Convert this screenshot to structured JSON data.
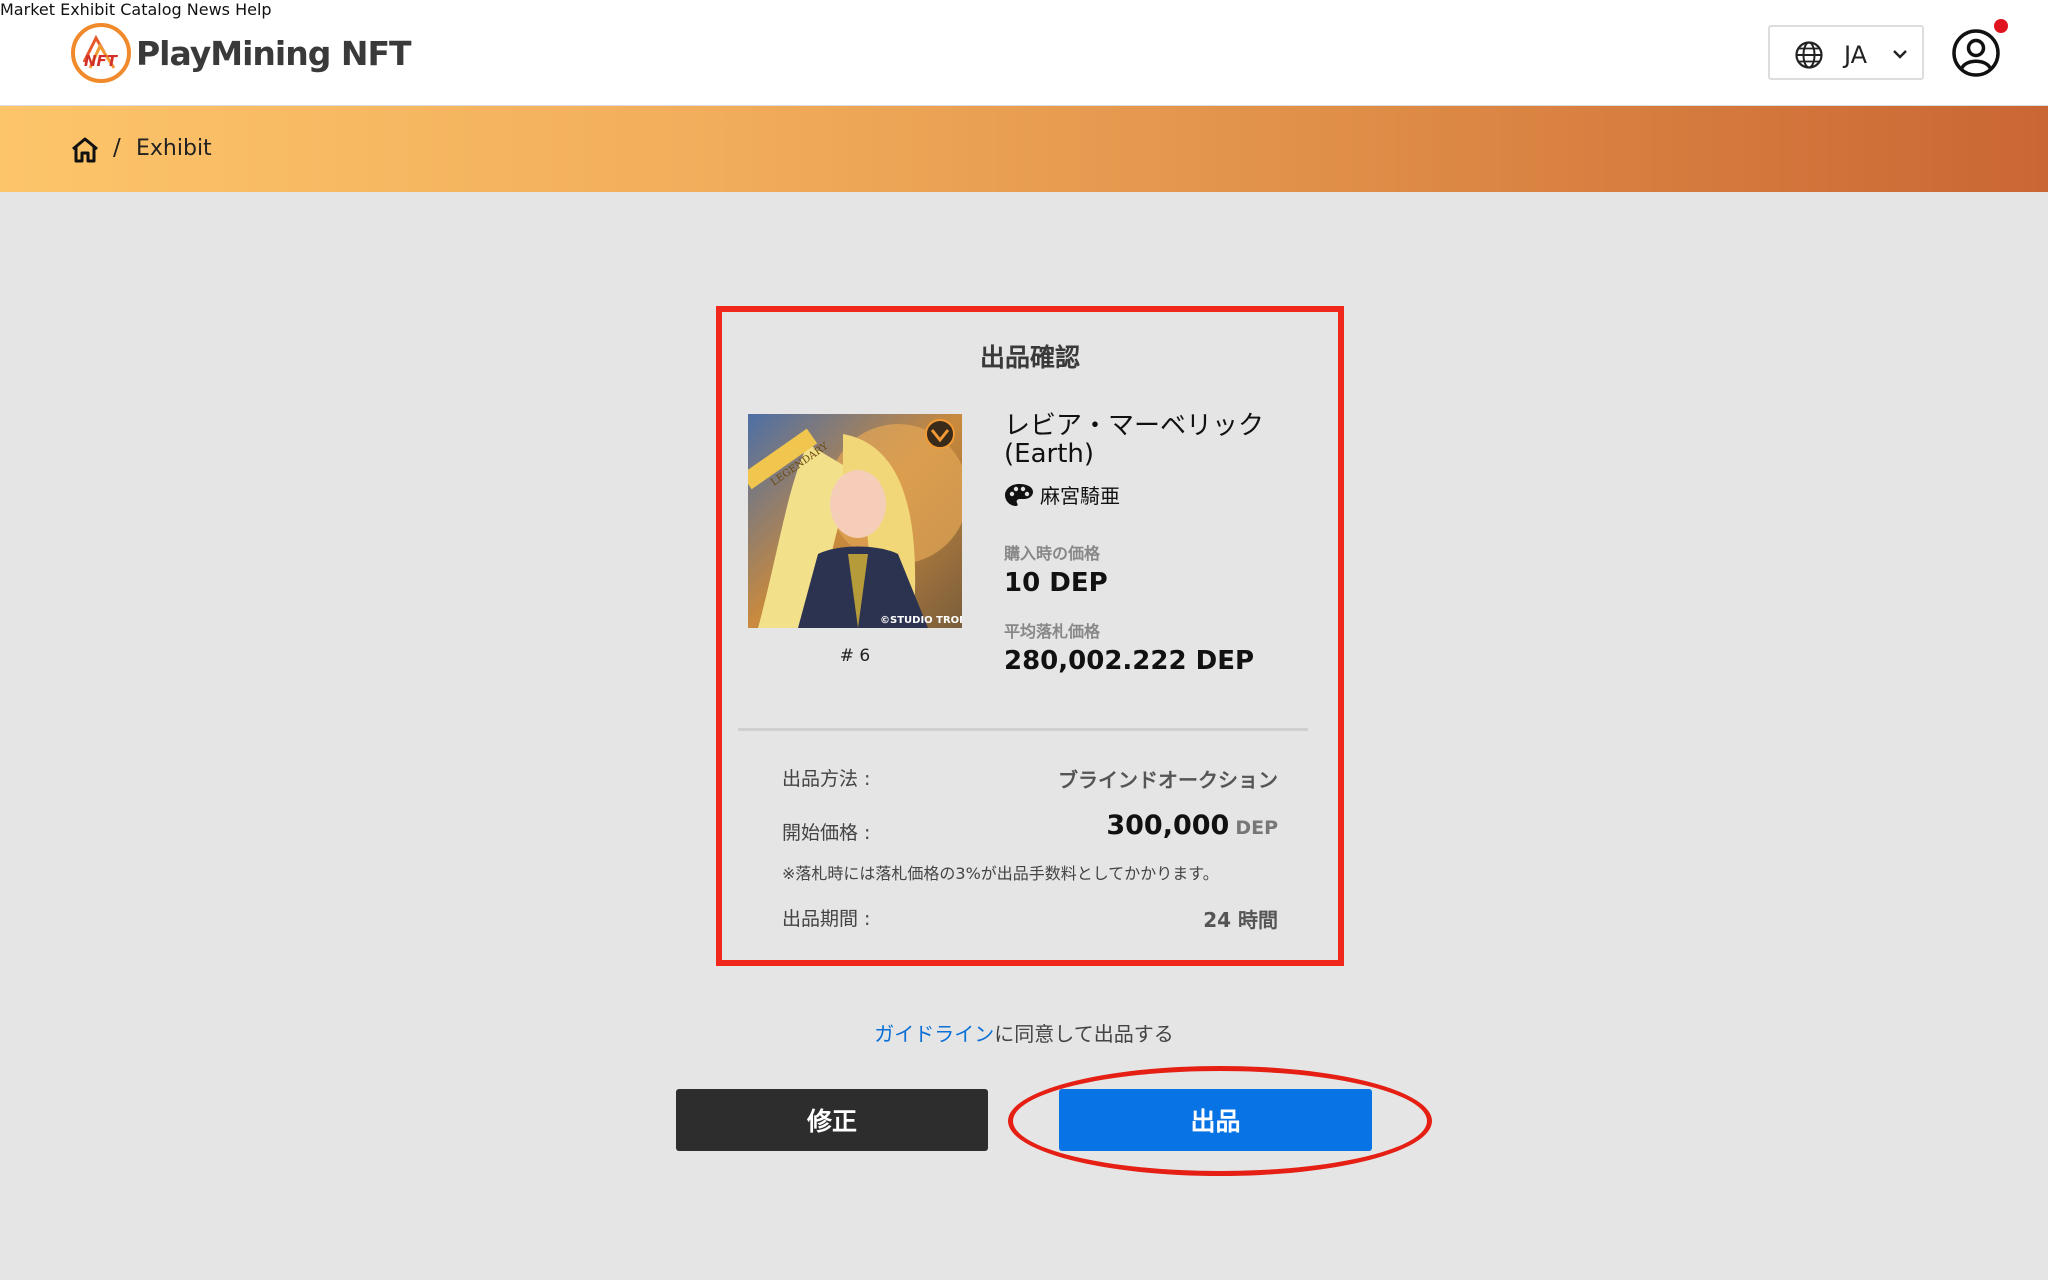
{
  "header": {
    "brand": "PlayMining NFT",
    "nav": [
      {
        "label": "Market"
      },
      {
        "label": "Exhibit"
      },
      {
        "label": "Catalog"
      },
      {
        "label": "News"
      },
      {
        "label": "Help"
      }
    ],
    "language": "JA",
    "icons": {
      "language": "globe-icon",
      "dropdown": "chevron-down-icon",
      "account": "user-circle-icon"
    },
    "notification_color": "#e0141f"
  },
  "breadcrumb": {
    "home_icon": "home-icon",
    "separator": "/",
    "current": "Exhibit"
  },
  "confirm": {
    "title": "出品確認",
    "item": {
      "name": "レビア・マーベリック (Earth)",
      "creator": "麻宮騎亜",
      "token_id": "# 6",
      "thumb_badge": "LEGENDARY",
      "thumb_credit": "©STUDIO TRON",
      "purchase_price_label": "購入時の価格",
      "purchase_price": "10 DEP",
      "avg_price_label": "平均落札価格",
      "avg_price": "280,002.222 DEP"
    },
    "method_label": "出品方法 :",
    "method_value": "ブラインドオークション",
    "start_price_label": "開始価格 :",
    "start_price_value": "300,000",
    "start_price_unit": "DEP",
    "fee_note": "※落札時には落札価格の3%が出品手数料としてかかります。",
    "period_label": "出品期間 :",
    "period_value": "24 時間"
  },
  "consent": {
    "link_text": "ガイドライン",
    "rest_text": "に同意して出品する"
  },
  "buttons": {
    "edit": "修正",
    "exhibit": "出品"
  },
  "colors": {
    "accent_blue": "#0873e4",
    "annotation_red": "#f0281c",
    "dark_button": "#2d2d2d"
  }
}
